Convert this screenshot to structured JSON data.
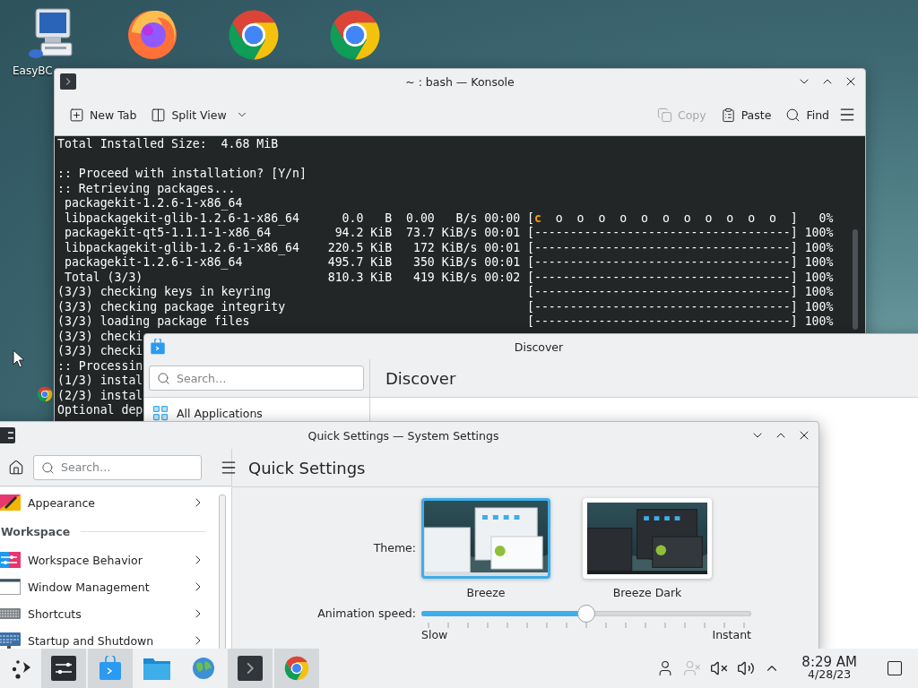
{
  "desktop_icons": [
    {
      "kind": "easybcd",
      "label": "EasyBC"
    },
    {
      "kind": "firefox"
    },
    {
      "kind": "chrome"
    },
    {
      "kind": "chrome"
    }
  ],
  "konsole": {
    "title": "~ : bash — Konsole",
    "toolbar_left": [
      {
        "kind": "new-tab",
        "label": "New Tab",
        "disabled": false
      },
      {
        "kind": "split-view",
        "label": "Split View",
        "disabled": false
      }
    ],
    "toolbar_right": [
      {
        "kind": "copy",
        "label": "Copy",
        "disabled": true
      },
      {
        "kind": "paste",
        "label": "Paste",
        "disabled": false
      },
      {
        "kind": "find",
        "label": "Find",
        "disabled": false
      }
    ],
    "lines": [
      {
        "kind": "text",
        "text": "Total Installed Size:  4.68 MiB"
      },
      {
        "kind": "blank"
      },
      {
        "kind": "text",
        "text": ":: Proceed with installation? [Y/n]"
      },
      {
        "kind": "text",
        "text": ":: Retrieving packages..."
      },
      {
        "kind": "text",
        "text": " packagekit-1.2.6-1-x86_64"
      },
      {
        "kind": "pacman",
        "text": " libpackagekit-glib-1.2.6-1-x86_64      0.0   B  0.00   B/s 00:00 [",
        "pacman": "c",
        "rest": "  o  o  o  o  o  o  o  o  o  o  o  ]   0%"
      },
      {
        "kind": "text",
        "text": " packagekit-qt5-1.1.1-1-x86_64         94.2 KiB  73.7 KiB/s 00:01 [------------------------------------] 100%"
      },
      {
        "kind": "text",
        "text": " libpackagekit-glib-1.2.6-1-x86_64    220.5 KiB   172 KiB/s 00:01 [------------------------------------] 100%"
      },
      {
        "kind": "text",
        "text": " packagekit-1.2.6-1-x86_64            495.7 KiB   350 KiB/s 00:01 [------------------------------------] 100%"
      },
      {
        "kind": "text",
        "text": " Total (3/3)                          810.3 KiB   419 KiB/s 00:02 [------------------------------------] 100%"
      },
      {
        "kind": "text",
        "text": "(3/3) checking keys in keyring                                    [------------------------------------] 100%"
      },
      {
        "kind": "text",
        "text": "(3/3) checking package integrity                                  [------------------------------------] 100%"
      },
      {
        "kind": "text",
        "text": "(3/3) loading package files                                       [------------------------------------] 100%"
      },
      {
        "kind": "text",
        "text": "(3/3) checki"
      },
      {
        "kind": "text",
        "text": "(3/3) checki"
      },
      {
        "kind": "text",
        "text": ":: Processin"
      },
      {
        "kind": "text",
        "text": "(1/3) instal"
      },
      {
        "kind": "text",
        "text": "(2/3) instal"
      },
      {
        "kind": "text",
        "text": "Optional dep"
      }
    ]
  },
  "discover": {
    "title": "Discover",
    "search": {
      "placeholder": "Search…"
    },
    "heading": "Discover",
    "nav": [
      {
        "label": "All Applications"
      }
    ]
  },
  "settings": {
    "title": "Quick Settings — System Settings",
    "search": {
      "placeholder": "Search…"
    },
    "heading": "Quick Settings",
    "sidebar": [
      {
        "kind": "item",
        "label": "Appearance"
      },
      {
        "kind": "section",
        "label": "Workspace"
      },
      {
        "kind": "item",
        "label": "Workspace Behavior"
      },
      {
        "kind": "item",
        "label": "Window Management"
      },
      {
        "kind": "item",
        "label": "Shortcuts"
      },
      {
        "kind": "item",
        "label": "Startup and Shutdown"
      }
    ],
    "theme": {
      "label": "Theme:",
      "options": [
        {
          "label": "Breeze",
          "kind": "light",
          "selected": true
        },
        {
          "label": "Breeze Dark",
          "kind": "dark",
          "selected": false
        }
      ]
    },
    "animation": {
      "label": "Animation speed:",
      "level": 0.5,
      "min_label": "Slow",
      "max_label": "Instant"
    }
  },
  "taskbar": {
    "tasks": [
      {
        "kind": "settings",
        "active": true
      },
      {
        "kind": "discover",
        "active": true
      },
      {
        "kind": "files",
        "active": false
      },
      {
        "kind": "globe",
        "active": false
      },
      {
        "kind": "terminal",
        "active": true
      },
      {
        "kind": "chrome",
        "active": true
      }
    ],
    "clock": {
      "time": "8:29 AM",
      "date": "4/28/23"
    }
  }
}
